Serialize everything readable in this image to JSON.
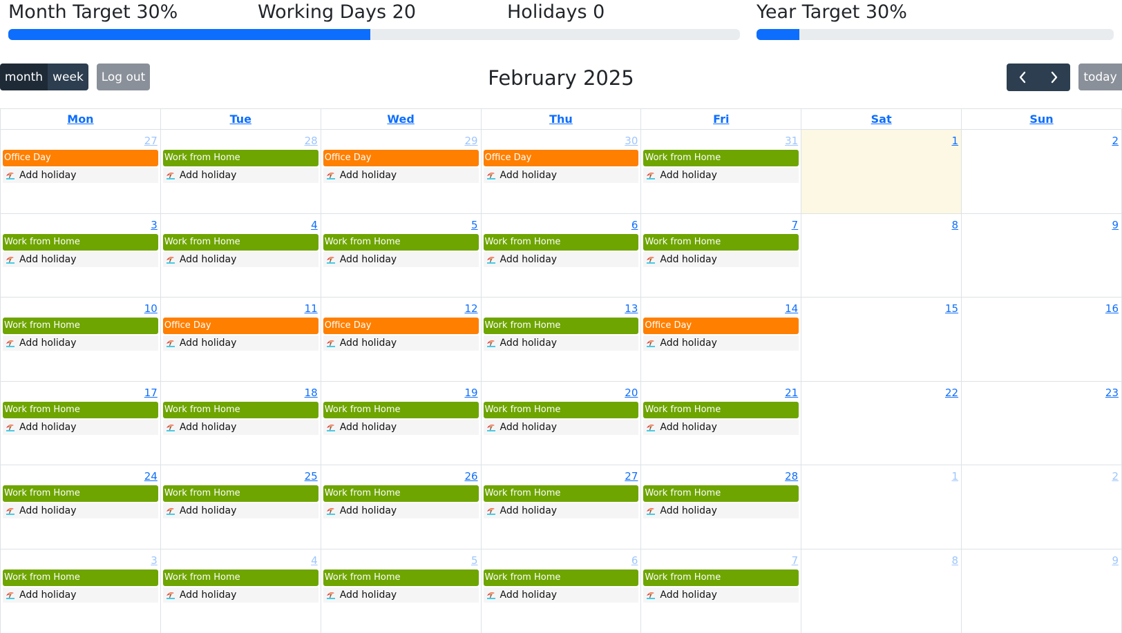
{
  "stats": {
    "month_target": "Month Target 30%",
    "working_days": "Working Days 20",
    "holidays": "Holidays 0",
    "year_target": "Year Target 30%",
    "month_progress_percent": 49.5,
    "year_progress_percent": 12
  },
  "toolbar": {
    "month_label": "month",
    "week_label": "week",
    "logout_label": "Log out",
    "title": "February 2025",
    "today_label": "today"
  },
  "weekdays": [
    "Mon",
    "Tue",
    "Wed",
    "Thu",
    "Fri",
    "Sat",
    "Sun"
  ],
  "colors": {
    "office": "#ff7f00",
    "wfh": "#6ea500",
    "today_bg": "#fcf8e3",
    "link": "#0d6efd",
    "progress": "#0d6efd"
  },
  "event_labels": {
    "office": "Office Day",
    "wfh": "Work from Home",
    "holiday": "Add holiday"
  },
  "weeks": [
    [
      {
        "day": "27",
        "other": true,
        "event": "office"
      },
      {
        "day": "28",
        "other": true,
        "event": "wfh"
      },
      {
        "day": "29",
        "other": true,
        "event": "office"
      },
      {
        "day": "30",
        "other": true,
        "event": "office"
      },
      {
        "day": "31",
        "other": true,
        "event": "wfh"
      },
      {
        "day": "1",
        "other": false,
        "today": true
      },
      {
        "day": "2",
        "other": false
      }
    ],
    [
      {
        "day": "3",
        "event": "wfh"
      },
      {
        "day": "4",
        "event": "wfh"
      },
      {
        "day": "5",
        "event": "wfh"
      },
      {
        "day": "6",
        "event": "wfh"
      },
      {
        "day": "7",
        "event": "wfh"
      },
      {
        "day": "8"
      },
      {
        "day": "9"
      }
    ],
    [
      {
        "day": "10",
        "event": "wfh"
      },
      {
        "day": "11",
        "event": "office"
      },
      {
        "day": "12",
        "event": "office"
      },
      {
        "day": "13",
        "event": "wfh"
      },
      {
        "day": "14",
        "event": "office"
      },
      {
        "day": "15"
      },
      {
        "day": "16"
      }
    ],
    [
      {
        "day": "17",
        "event": "wfh"
      },
      {
        "day": "18",
        "event": "wfh"
      },
      {
        "day": "19",
        "event": "wfh"
      },
      {
        "day": "20",
        "event": "wfh"
      },
      {
        "day": "21",
        "event": "wfh"
      },
      {
        "day": "22"
      },
      {
        "day": "23"
      }
    ],
    [
      {
        "day": "24",
        "event": "wfh"
      },
      {
        "day": "25",
        "event": "wfh"
      },
      {
        "day": "26",
        "event": "wfh"
      },
      {
        "day": "27",
        "event": "wfh"
      },
      {
        "day": "28",
        "event": "wfh"
      },
      {
        "day": "1",
        "other": true
      },
      {
        "day": "2",
        "other": true
      }
    ],
    [
      {
        "day": "3",
        "other": true,
        "event": "wfh"
      },
      {
        "day": "4",
        "other": true,
        "event": "wfh"
      },
      {
        "day": "5",
        "other": true,
        "event": "wfh"
      },
      {
        "day": "6",
        "other": true,
        "event": "wfh"
      },
      {
        "day": "7",
        "other": true,
        "event": "wfh"
      },
      {
        "day": "8",
        "other": true
      },
      {
        "day": "9",
        "other": true
      }
    ]
  ]
}
